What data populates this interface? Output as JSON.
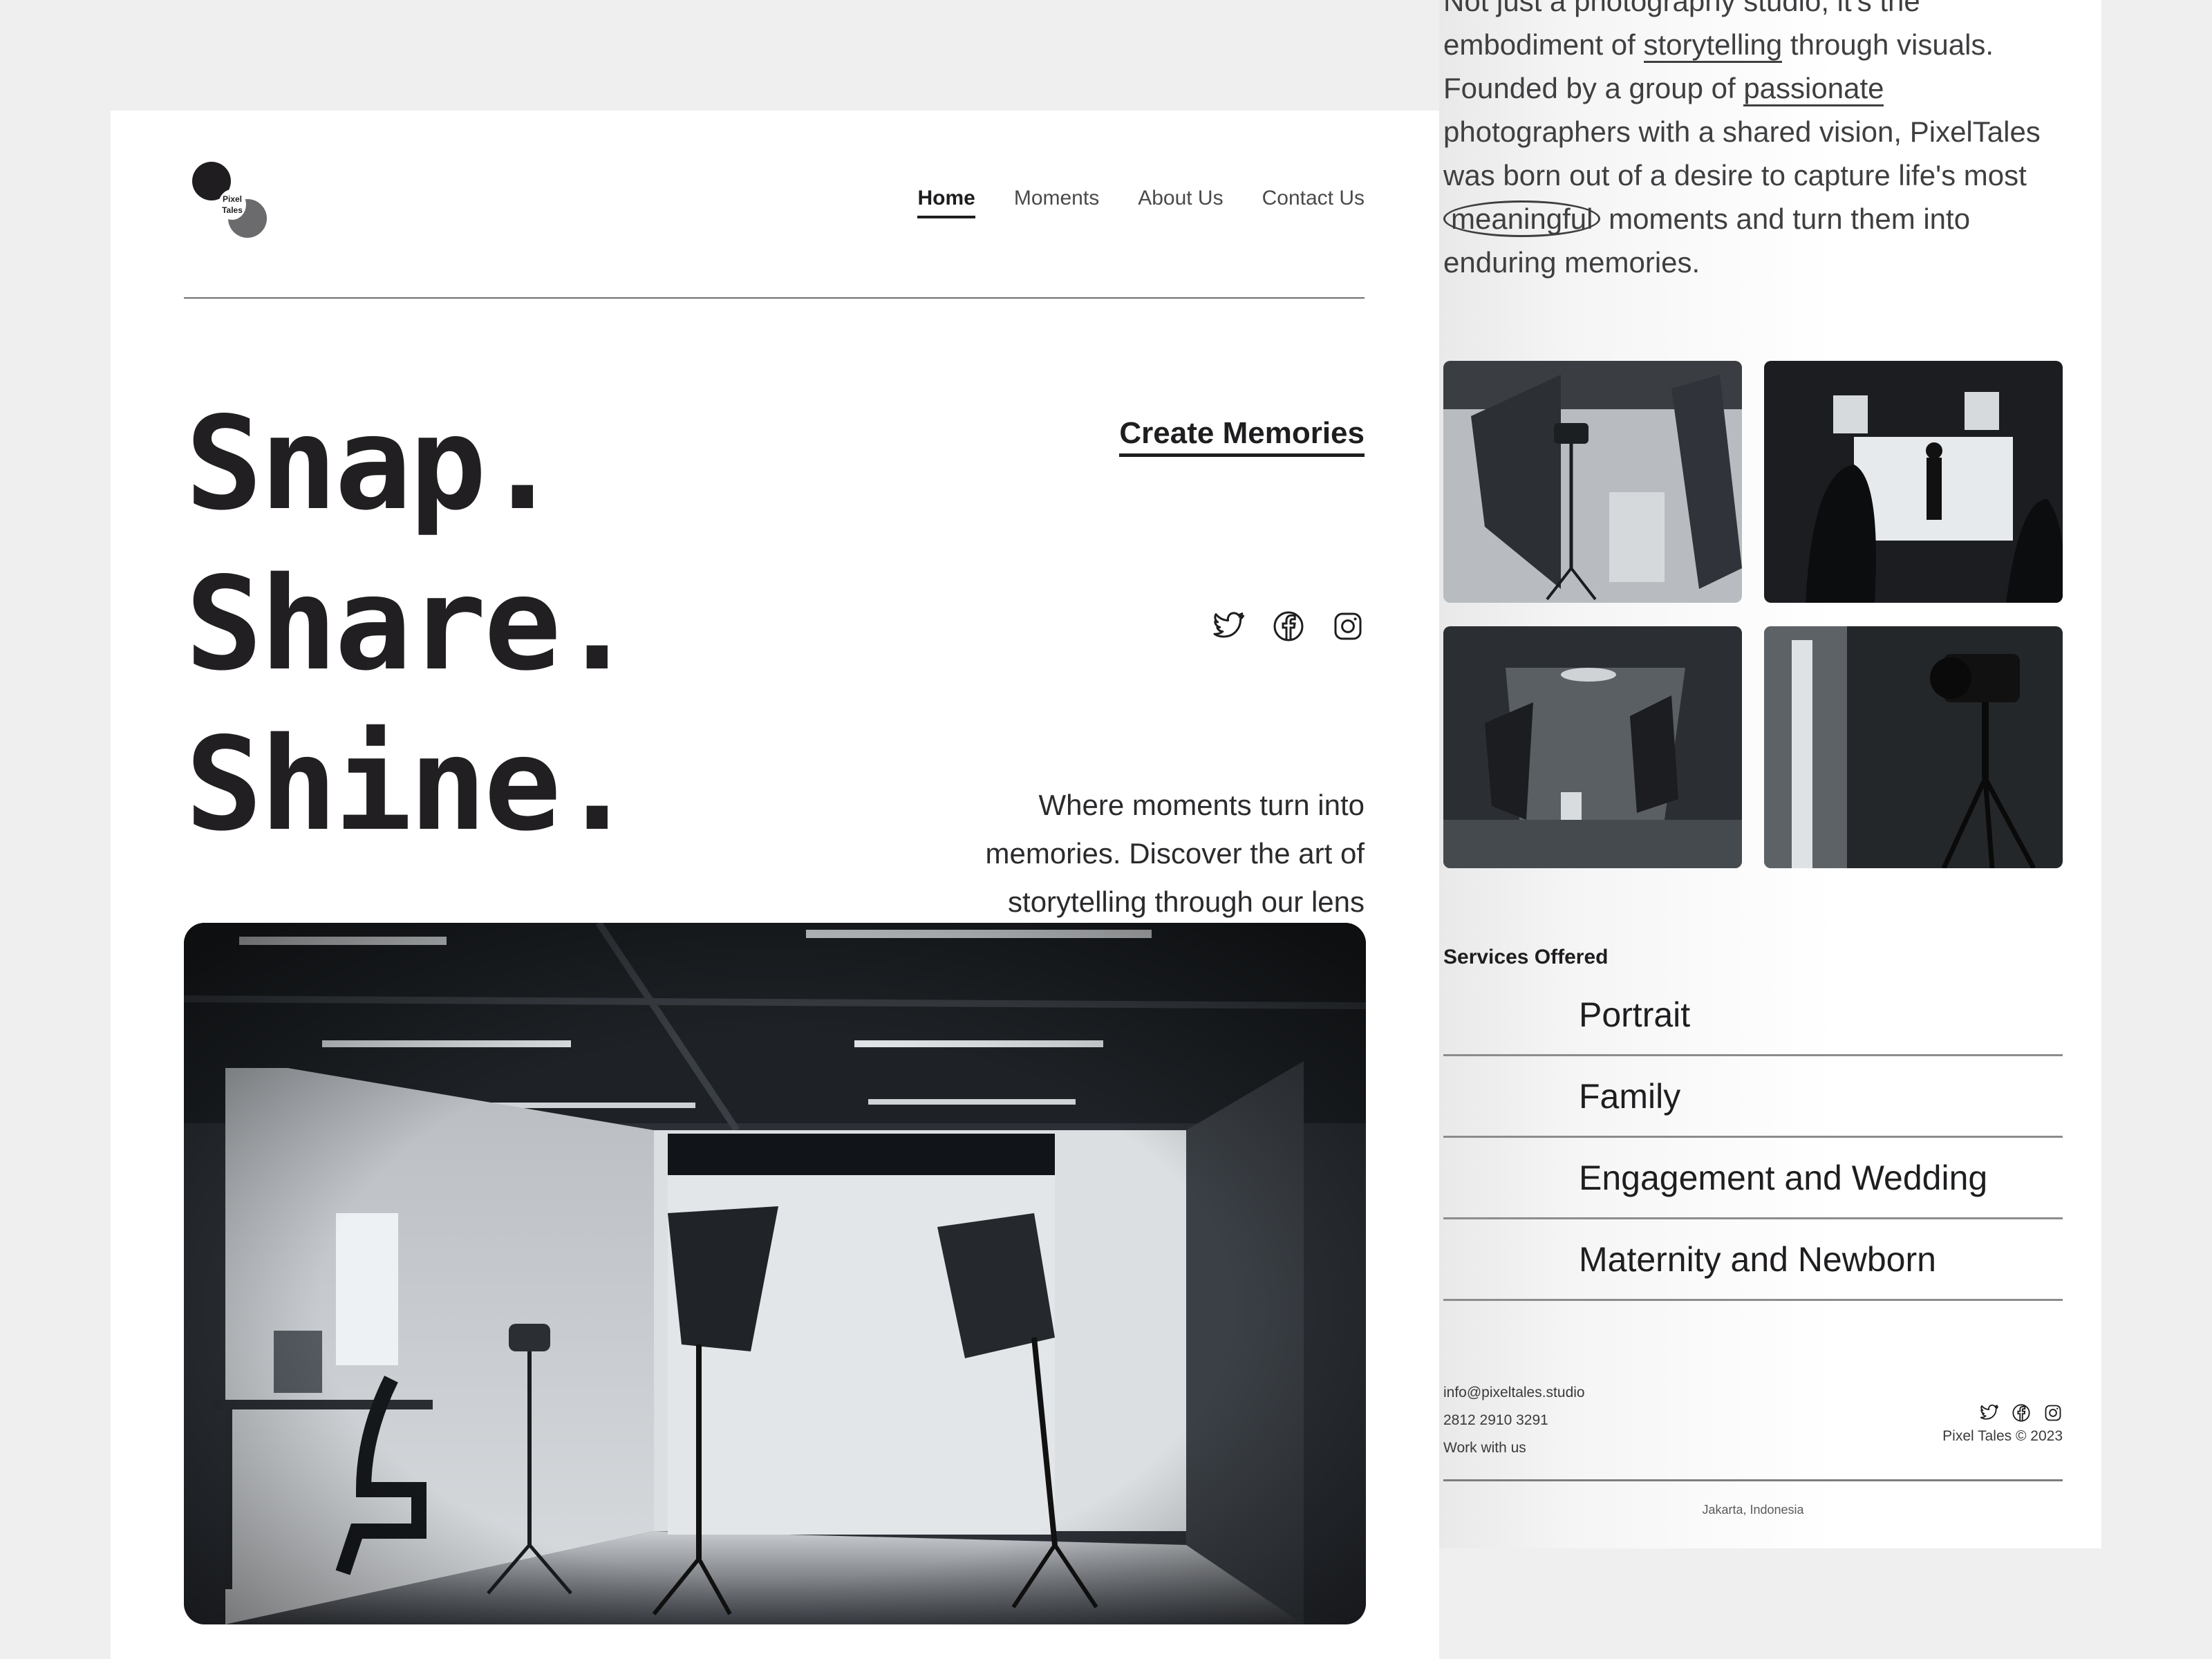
{
  "brand": {
    "logo_line1": "Pixel",
    "logo_line2": "Tales"
  },
  "nav": {
    "items": [
      {
        "label": "Home",
        "active": true
      },
      {
        "label": "Moments"
      },
      {
        "label": "About Us"
      },
      {
        "label": "Contact Us"
      }
    ]
  },
  "hero": {
    "title_lines": [
      "Snap.",
      "Share.",
      "Shine."
    ],
    "cta": "Create Memories",
    "tagline": "Where moments turn into memories. Discover the art of storytelling through our lens"
  },
  "social": {
    "icons": [
      "twitter-icon",
      "facebook-icon",
      "instagram-icon"
    ]
  },
  "about": {
    "p1": "Not just a photography studio, it's the embodiment of ",
    "w1": "storytelling",
    "p2": " through visuals. Founded by a group of ",
    "w2": "passionate",
    "p3": " photographers with a shared vision, PixelTales was born out of a desire to capture life's most ",
    "w3": "meaningful",
    "p4": " moments and turn them into enduring memories."
  },
  "services": {
    "label": "Services Offered",
    "items": [
      "Portrait",
      "Family",
      "Engagement and Wedding",
      "Maternity and Newborn"
    ]
  },
  "footer": {
    "email": "info@pixeltales.studio",
    "phone": "2812 2910 3291",
    "work": "Work with us",
    "copyright": "Pixel Tales © 2023",
    "location": "Jakarta, Indonesia"
  },
  "colors": {
    "ink": "#1f1d20",
    "paper": "#ffffff",
    "backdrop": "#efeff0",
    "photo_dark": "#2c3036"
  }
}
